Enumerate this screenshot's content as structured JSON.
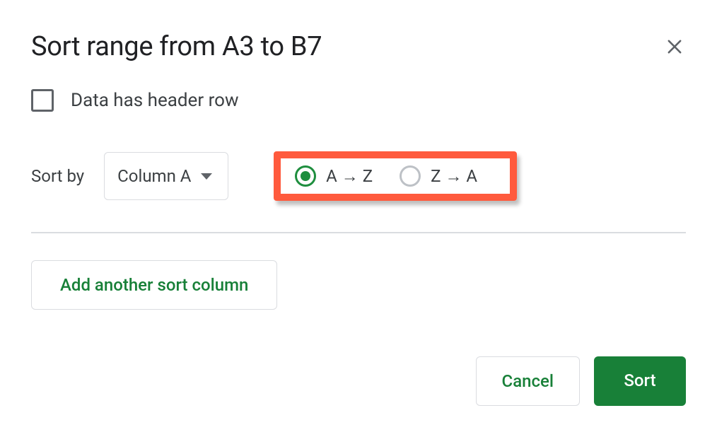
{
  "dialog": {
    "title": "Sort range from A3 to B7",
    "checkbox_label": "Data has header row",
    "checkbox_checked": false,
    "sort_by_label": "Sort by",
    "column_selected": "Column A",
    "radio_options": {
      "asc_label": "A → Z",
      "desc_label": "Z → A",
      "selected": "asc"
    },
    "add_column_label": "Add another sort column",
    "cancel_label": "Cancel",
    "sort_label": "Sort"
  },
  "colors": {
    "accent_green": "#188038",
    "highlight_border": "#ff5a3d",
    "text_primary": "#202124",
    "text_secondary": "#5f6368",
    "border": "#dadce0"
  }
}
